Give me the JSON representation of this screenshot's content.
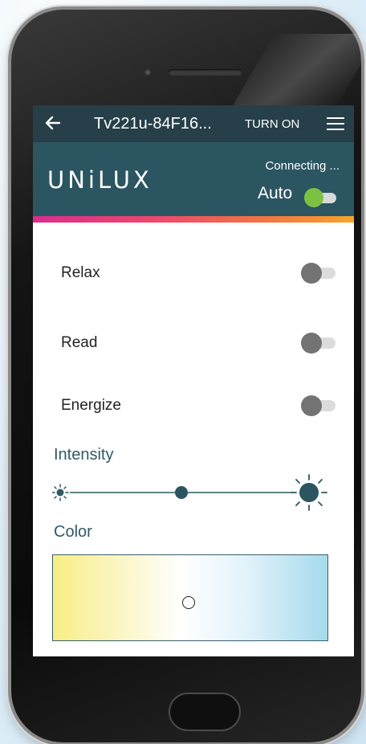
{
  "app_bar": {
    "back_icon": "arrow-left-icon",
    "title": "Tv221u-84F16...",
    "turn_on_label": "TURN ON",
    "menu_icon": "hamburger-menu-icon"
  },
  "header": {
    "brand": "UNiLUX",
    "status": "Connecting ...",
    "auto_label": "Auto",
    "auto_on": true
  },
  "modes": [
    {
      "label": "Relax",
      "on": false
    },
    {
      "label": "Read",
      "on": false
    },
    {
      "label": "Energize",
      "on": false
    }
  ],
  "intensity": {
    "title": "Intensity",
    "level": 0.5,
    "min_icon": "sun-small-icon",
    "max_icon": "sun-large-icon"
  },
  "color": {
    "title": "Color",
    "cursor_x": 0.49,
    "cursor_y": 0.55
  },
  "colors": {
    "appbar": "#263f48",
    "header": "#2b5561",
    "toggle_on": "#7cc242",
    "toggle_off": "#737373",
    "accent_text": "#2f5a66"
  }
}
